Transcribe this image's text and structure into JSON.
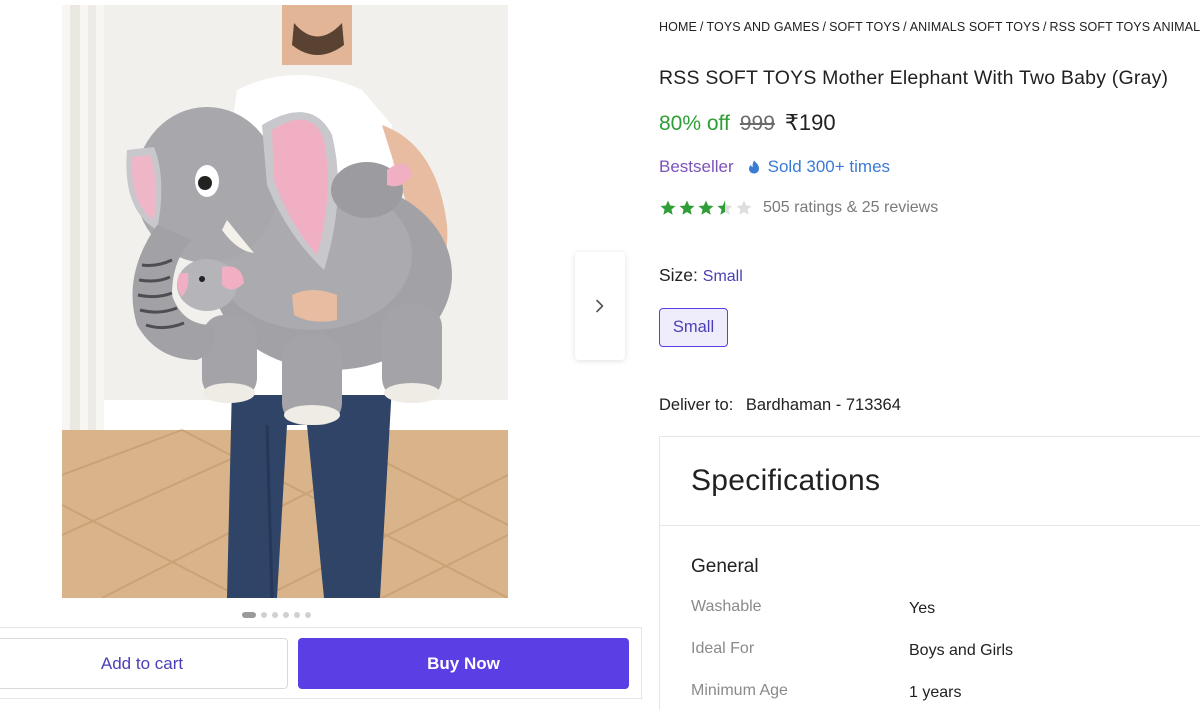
{
  "breadcrumb": {
    "items": [
      "HOME",
      "TOYS AND GAMES",
      "SOFT TOYS",
      "ANIMALS SOFT TOYS",
      "RSS SOFT TOYS ANIMALS"
    ],
    "separator": "/"
  },
  "product": {
    "title": "RSS SOFT TOYS Mother Elephant With Two Baby (Gray)",
    "discount": "80% off",
    "mrp": "999",
    "price": "₹190",
    "bestseller": "Bestseller",
    "sold": "Sold 300+ times",
    "rating_stars": 3.5,
    "ratings_text": "505 ratings",
    "reviews_text": "& 25 reviews"
  },
  "size": {
    "label": "Size:",
    "selected": "Small",
    "options": [
      "Small"
    ]
  },
  "delivery": {
    "label": "Deliver to:",
    "value": "Bardhaman - 713364"
  },
  "specifications": {
    "heading": "Specifications",
    "group": "General",
    "rows": [
      {
        "key": "Washable",
        "value": "Yes"
      },
      {
        "key": "Ideal For",
        "value": "Boys and Girls"
      },
      {
        "key": "Minimum Age",
        "value": "1 years"
      }
    ]
  },
  "gallery": {
    "image_count": 6,
    "active_index": 0
  },
  "actions": {
    "add_to_cart": "Add to cart",
    "buy_now": "Buy Now"
  },
  "colors": {
    "discount_green": "#2f9e36",
    "accent_purple": "#5b3fe4",
    "bestseller_purple": "#7c53b8",
    "sold_blue": "#3a7bd5",
    "star_green": "#2f9e36"
  },
  "icons": {
    "next": "chevron-right-icon",
    "sold": "flame-icon",
    "star": "star-icon"
  }
}
